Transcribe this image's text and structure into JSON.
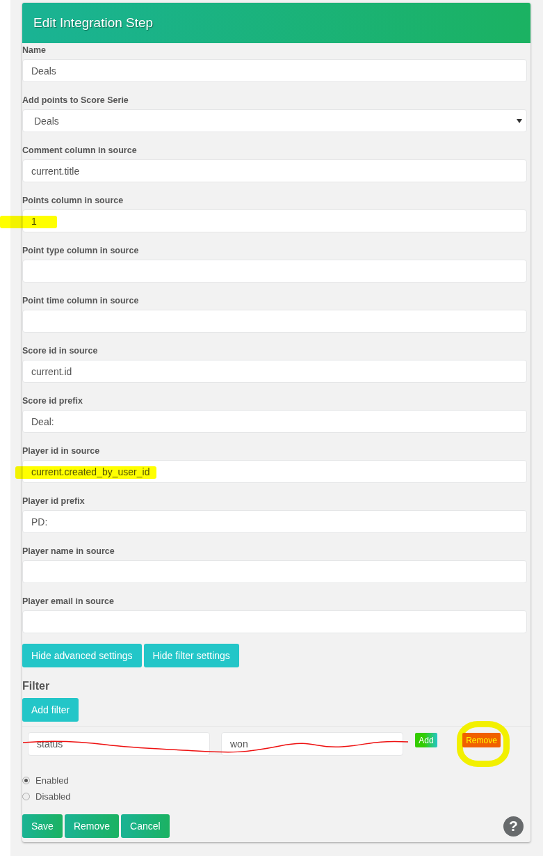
{
  "title": "Edit Integration Step",
  "fields": [
    {
      "label": "Name",
      "kind": "text",
      "value": "Deals",
      "highlighted": false
    },
    {
      "label": "Add points to Score Serie",
      "kind": "select",
      "value": "Deals",
      "highlighted": false
    },
    {
      "label": "Comment column in source",
      "kind": "text",
      "value": "current.title",
      "highlighted": false
    },
    {
      "label": "Points column in source",
      "kind": "text",
      "value": "1",
      "highlighted": true
    },
    {
      "label": "Point type column in source",
      "kind": "text",
      "highlighted": false
    },
    {
      "label": "Point time column in source",
      "kind": "text",
      "highlighted": false
    },
    {
      "label": "Score id in source",
      "kind": "text",
      "value": "current.id",
      "highlighted": false
    },
    {
      "label": "Score id prefix",
      "kind": "text",
      "value": "Deal:",
      "highlighted": false
    },
    {
      "label": "Player id in source",
      "kind": "text",
      "value": "current.created_by_user_id",
      "highlighted": true
    },
    {
      "label": "Player id prefix",
      "kind": "text",
      "value": "PD:",
      "highlighted": false
    },
    {
      "label": "Player name in source",
      "kind": "text",
      "highlighted": false
    },
    {
      "label": "Player email in source",
      "kind": "text",
      "highlighted": false
    }
  ],
  "settings_buttons": [
    "Hide advanced settings",
    "Hide filter settings"
  ],
  "filter": {
    "heading": "Filter",
    "add_button": "Add filter",
    "rows": [
      {
        "key": "status",
        "value": "won",
        "add_label": "Add",
        "remove_label": "Remove",
        "crossed_out": true,
        "remove_circled": true
      }
    ]
  },
  "status_options": [
    {
      "label": "Enabled",
      "selected": true
    },
    {
      "label": "Disabled",
      "selected": false
    }
  ],
  "actions": [
    "Save",
    "Remove",
    "Cancel"
  ],
  "help": "?"
}
